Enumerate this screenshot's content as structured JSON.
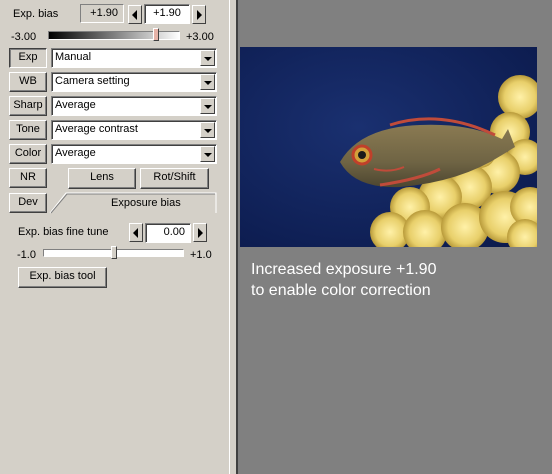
{
  "exp_bias": {
    "label": "Exp. bias",
    "readout": "+1.90",
    "value": "+1.90",
    "min_label": "-3.00",
    "max_label": "+3.00",
    "slider_value": 1.9
  },
  "rows": [
    {
      "button": "Exp",
      "value": "Manual"
    },
    {
      "button": "WB",
      "value": "Camera setting"
    },
    {
      "button": "Sharp",
      "value": "Average"
    },
    {
      "button": "Tone",
      "value": "Average contrast"
    },
    {
      "button": "Color",
      "value": "Average"
    }
  ],
  "nr_button": "NR",
  "dev_button": "Dev",
  "tabs": {
    "lens": "Lens",
    "rot_shift": "Rot/Shift",
    "exposure_bias": "Exposure bias"
  },
  "fine_tune": {
    "label": "Exp. bias fine tune",
    "value": "0.00",
    "min_label": "-1.0",
    "max_label": "+1.0",
    "slider_value": 0.0
  },
  "tool_button": "Exp. bias tool",
  "caption_lines": [
    "Increased exposure +1.90",
    "to enable color correction"
  ],
  "colors": {
    "panel": "#d4d0c8",
    "viewer_bg": "#808080",
    "water": "#0e1f5a"
  }
}
